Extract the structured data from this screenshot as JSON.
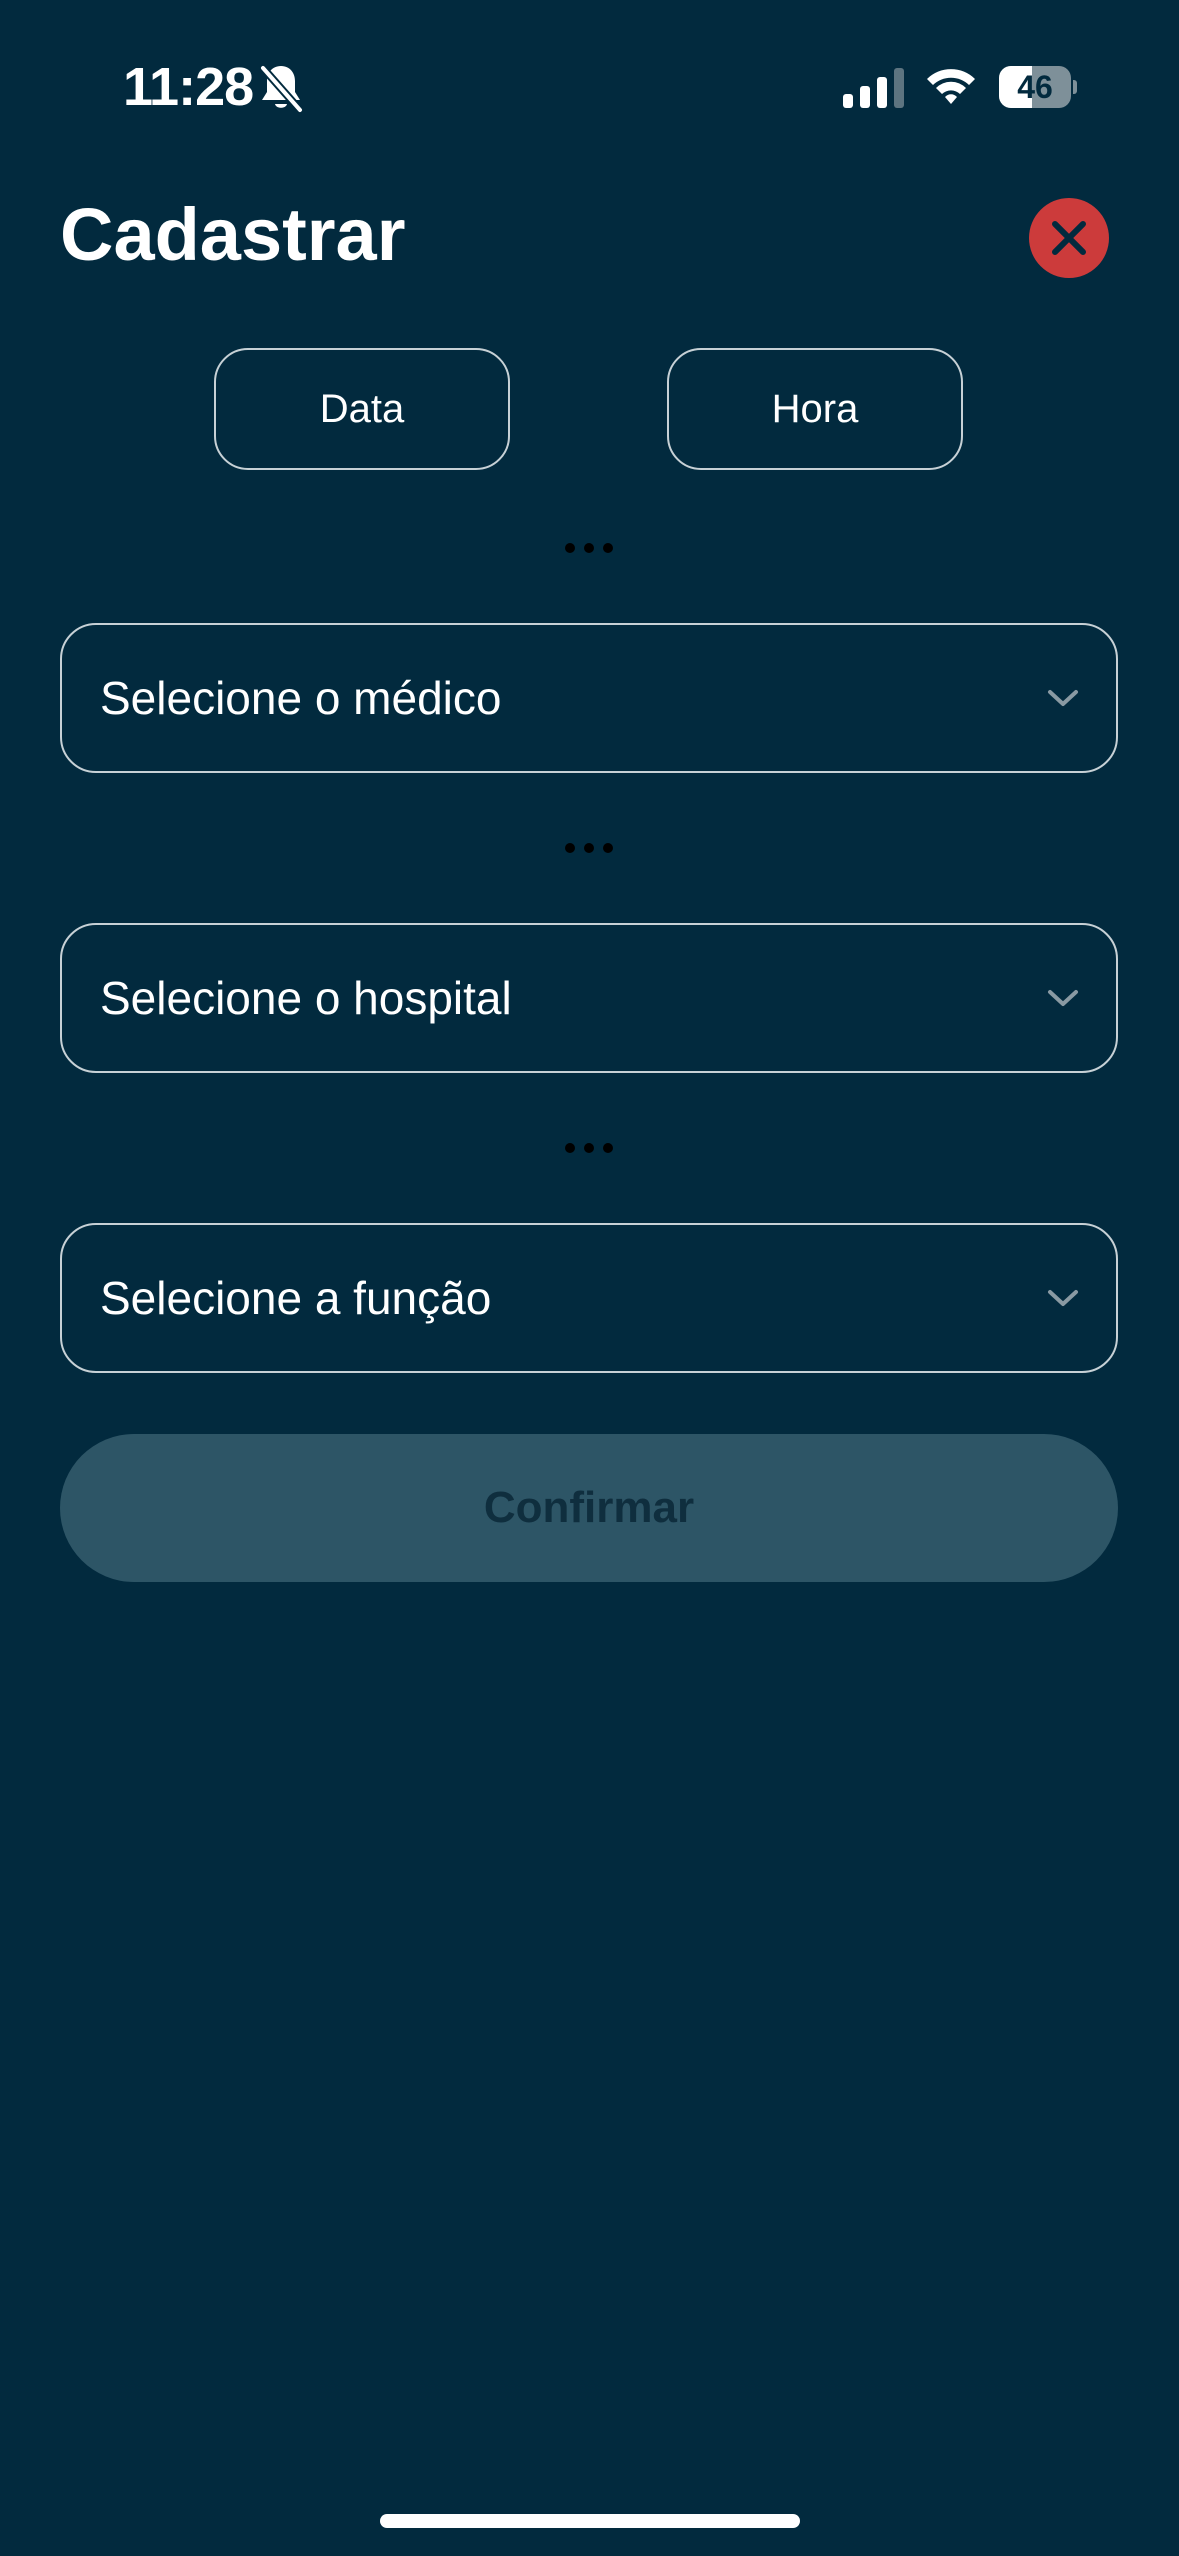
{
  "status_bar": {
    "time": "11:28",
    "battery_level": "46",
    "battery_fraction": 0.46,
    "icons": [
      "bell-slash-icon",
      "signal-icon",
      "wifi-icon",
      "battery-icon"
    ]
  },
  "header": {
    "title": "Cadastrar",
    "close_icon": "close-icon"
  },
  "datetime": {
    "date_label": "Data",
    "time_label": "Hora"
  },
  "form": {
    "doctor_select": {
      "placeholder": "Selecione o médico"
    },
    "hospital_select": {
      "placeholder": "Selecione o hospital"
    },
    "role_select": {
      "placeholder": "Selecione a função"
    },
    "confirm_label": "Confirmar",
    "confirm_enabled": false
  },
  "colors": {
    "background": "#022a3e",
    "close_button": "#cc3b3b",
    "confirm_disabled_bg": "#2d5566",
    "confirm_disabled_text": "#0f2e3e",
    "border": "#c7d1d6",
    "chevron": "#8a9aa3"
  }
}
